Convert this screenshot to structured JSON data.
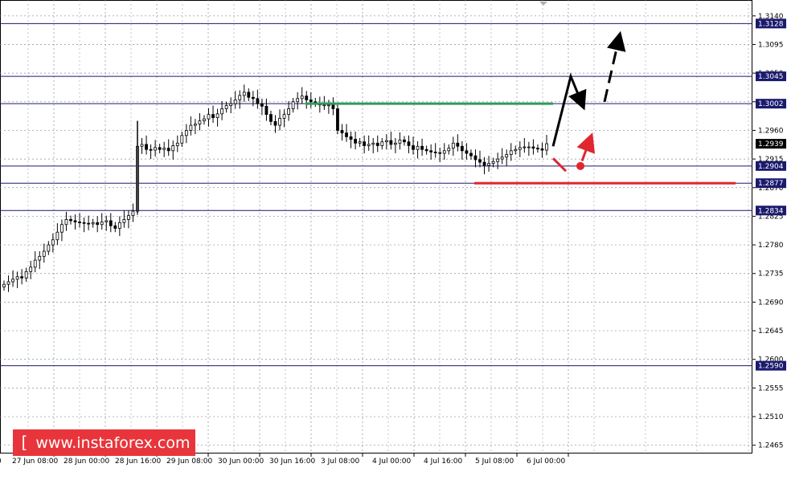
{
  "watermark": {
    "open": "[",
    "text": "www.instaforex.com",
    "close": "]"
  },
  "colors": {
    "background": "#ffffff",
    "grid": "#8a8aa0",
    "candle": "#000000",
    "level_line": "#1a1a6e",
    "label_bg": "#1a1a6e",
    "current_label_bg": "#000000",
    "green_resistance": "#2e9a5a",
    "red_support": "#e0262f",
    "forecast_black": "#000000",
    "forecast_red": "#e0262f",
    "watermark_bg": "#e8353b"
  },
  "chart_data": {
    "type": "candlestick",
    "instrument_note": "",
    "y_axis": {
      "range": [
        1.2452,
        1.3165
      ],
      "ticks": [
        "1.3140",
        "1.3095",
        "1.3050",
        "1.3005",
        "1.2960",
        "1.2915",
        "1.2870",
        "1.2825",
        "1.2780",
        "1.2735",
        "1.2690",
        "1.2645",
        "1.2600",
        "1.2555",
        "1.2510",
        "1.2465"
      ]
    },
    "x_axis": {
      "ticks": [
        "27 Jun 08:00",
        "28 Jun 00:00",
        "28 Jun 16:00",
        "29 Jun 08:00",
        "30 Jun 00:00",
        "30 Jun 16:00",
        "3 Jul 08:00",
        "4 Jul 00:00",
        "4 Jul 16:00",
        "5 Jul 08:00",
        "6 Jul 00:00"
      ],
      "leading_fragment": "0"
    },
    "horizontal_levels": [
      {
        "value": 1.3128,
        "label": "1.3128"
      },
      {
        "value": 1.3045,
        "label": "1.3045"
      },
      {
        "value": 1.3002,
        "label": "1.3002"
      },
      {
        "value": 1.2904,
        "label": "1.2904"
      },
      {
        "value": 1.2877,
        "label": "1.2877"
      },
      {
        "value": 1.2834,
        "label": "1.2834"
      },
      {
        "value": 1.259,
        "label": "1.2590"
      }
    ],
    "current_price": {
      "value": 1.2939,
      "label": "1.2939"
    },
    "close_series": [
      1.2718,
      1.2722,
      1.2726,
      1.273,
      1.2728,
      1.2738,
      1.2745,
      1.2756,
      1.2762,
      1.277,
      1.278,
      1.2788,
      1.28,
      1.2812,
      1.282,
      1.2818,
      1.2816,
      1.2815,
      1.2814,
      1.2813,
      1.2815,
      1.2812,
      1.2816,
      1.2818,
      1.281,
      1.2806,
      1.2815,
      1.282,
      1.2826,
      1.2833,
      1.2935,
      1.2938,
      1.293,
      1.2929,
      1.2933,
      1.293,
      1.2932,
      1.2928,
      1.2936,
      1.294,
      1.2952,
      1.296,
      1.2968,
      1.297,
      1.2975,
      1.2978,
      1.2985,
      1.298,
      1.2986,
      1.2994,
      1.2999,
      1.3002,
      1.3008,
      1.3015,
      1.302,
      1.3012,
      1.301,
      1.3002,
      1.2998,
      1.2985,
      1.2974,
      1.2968,
      1.2979,
      1.2985,
      1.2994,
      1.3005,
      1.301,
      1.3014,
      1.3008,
      1.3005,
      1.3003,
      1.3,
      1.3,
      1.3,
      1.2994,
      1.296,
      1.2956,
      1.295,
      1.2946,
      1.294,
      1.2942,
      1.2936,
      1.2938,
      1.294,
      1.2936,
      1.2942,
      1.2944,
      1.2938,
      1.294,
      1.2945,
      1.2942,
      1.2936,
      1.293,
      1.2935,
      1.293,
      1.2928,
      1.2926,
      1.2925,
      1.2924,
      1.2928,
      1.2932,
      1.294,
      1.2935,
      1.2928,
      1.2924,
      1.292,
      1.2914,
      1.291,
      1.2905,
      1.2908,
      1.2911,
      1.2915,
      1.2918,
      1.2922,
      1.2928,
      1.293,
      1.2933,
      1.2934,
      1.2934,
      1.2932,
      1.2931,
      1.2929,
      1.2939
    ],
    "annotations": [
      {
        "type": "segment",
        "color": "green",
        "from": [
          "3 Jul 08:00 (start)",
          1.3002
        ],
        "to": [
          "6 Jul ~08:00",
          1.3002
        ]
      },
      {
        "type": "segment",
        "color": "red",
        "from": [
          "5 Jul 00:00",
          1.2877
        ],
        "to": [
          "7 Jul",
          1.2877
        ]
      },
      {
        "type": "forecast_path",
        "color": "black",
        "note": "up to 1.3045, pullback to 1.3002, then arrow up toward 1.3128"
      },
      {
        "type": "forecast_path",
        "color": "red",
        "note": "dip to about 1.2904, then arrow up"
      }
    ],
    "grid": true
  }
}
